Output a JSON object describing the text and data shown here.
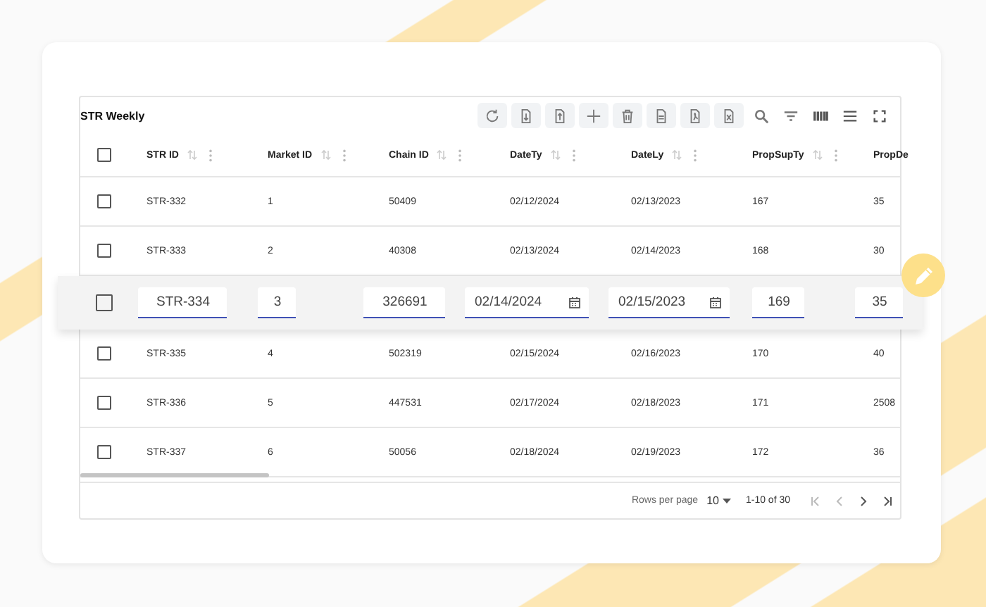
{
  "table": {
    "title": "STR Weekly",
    "toolbar": [
      {
        "kind": "refresh"
      },
      {
        "kind": "import"
      },
      {
        "kind": "export"
      },
      {
        "kind": "add"
      },
      {
        "kind": "delete"
      },
      {
        "kind": "csv"
      },
      {
        "kind": "pdf"
      },
      {
        "kind": "excel"
      },
      {
        "kind": "search"
      },
      {
        "kind": "filter"
      },
      {
        "kind": "columns"
      },
      {
        "kind": "density"
      },
      {
        "kind": "fullscreen"
      }
    ],
    "select_all": {
      "checked": false
    },
    "columns": [
      {
        "label": "STR ID"
      },
      {
        "label": "Market ID"
      },
      {
        "label": "Chain ID"
      },
      {
        "label": "DateTy"
      },
      {
        "label": "DateLy"
      },
      {
        "label": "PropSupTy"
      },
      {
        "label": "PropDe"
      }
    ],
    "rows": [
      {
        "checked": false,
        "editing": false,
        "cells": [
          "STR-332",
          "1",
          "50409",
          "02/12/2024",
          "02/13/2023",
          "167",
          "35"
        ]
      },
      {
        "checked": false,
        "editing": false,
        "cells": [
          "STR-333",
          "2",
          "40308",
          "02/13/2024",
          "02/14/2023",
          "168",
          "30"
        ]
      },
      {
        "checked": false,
        "editing": true,
        "cells": [
          "STR-334",
          "3",
          "326691",
          "02/14/2024",
          "02/15/2023",
          "169",
          "35"
        ]
      },
      {
        "checked": false,
        "editing": false,
        "cells": [
          "STR-335",
          "4",
          "502319",
          "02/15/2024",
          "02/16/2023",
          "170",
          "40"
        ]
      },
      {
        "checked": false,
        "editing": false,
        "cells": [
          "STR-336",
          "5",
          "447531",
          "02/17/2024",
          "02/18/2023",
          "171",
          "2508"
        ]
      },
      {
        "checked": false,
        "editing": false,
        "cells": [
          "STR-337",
          "6",
          "50056",
          "02/18/2024",
          "02/19/2023",
          "172",
          "36"
        ]
      }
    ],
    "footer": {
      "rows_per_page_label": "Rows per page",
      "rows_per_page": "10",
      "range": "1-10 of 30",
      "nav": [
        {
          "kind": "first",
          "disabled": true
        },
        {
          "kind": "prev",
          "disabled": true
        },
        {
          "kind": "next",
          "disabled": false
        },
        {
          "kind": "last",
          "disabled": false
        }
      ]
    }
  }
}
